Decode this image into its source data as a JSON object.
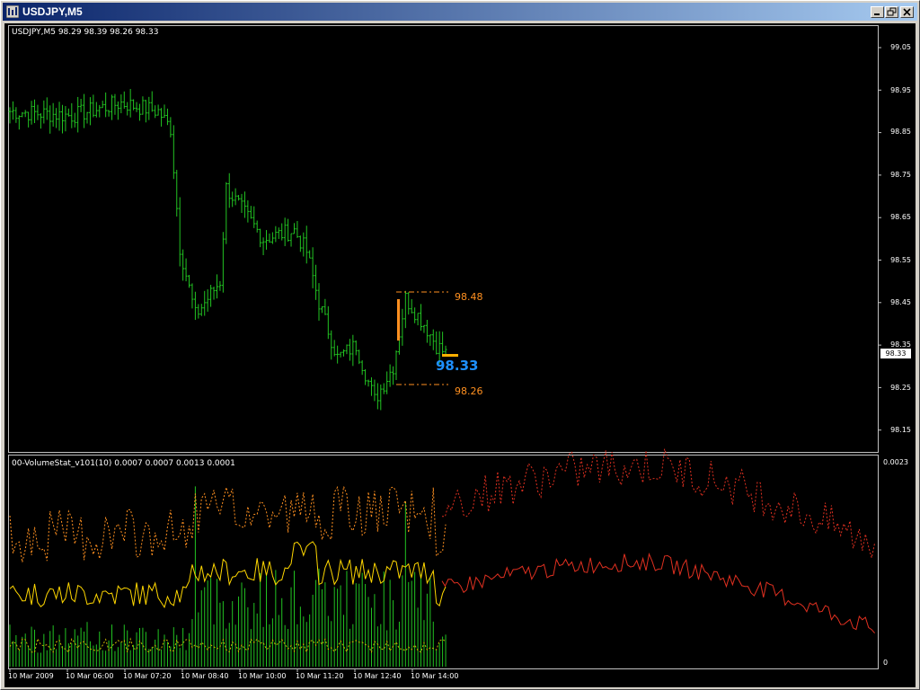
{
  "window": {
    "title": "USDJPY,M5",
    "controls": [
      "minimize",
      "restore",
      "close"
    ]
  },
  "chart": {
    "info_label": "USDJPY,M5  98.29 98.39 98.26 98.33",
    "price_ticks": [
      "99.05",
      "98.95",
      "98.85",
      "98.75",
      "98.65",
      "98.55",
      "98.45",
      "98.35",
      "98.25",
      "98.15"
    ],
    "current_price_box": "98.33",
    "range_high": "98.48",
    "range_low": "98.26",
    "current_price_big": "98.33",
    "colors": {
      "bars": "#22c422",
      "range_lines": "#ff9020",
      "current_price": "#1e90ff",
      "background": "#000000"
    }
  },
  "indicator": {
    "label": "00-VolumeStat_v101(10) 0.0007 0.0007 0.0013 0.0001",
    "scale_max": "0.0023",
    "scale_min": "0",
    "colors": {
      "volume_bars": "#22c422",
      "line_yellow": "#ffd700",
      "dotted_orange": "#ff9020",
      "projection_red": "#e03020"
    }
  },
  "time_axis": {
    "labels": [
      "10 Mar 2009",
      "10 Mar 06:00",
      "10 Mar 07:20",
      "10 Mar 08:40",
      "10 Mar 10:00",
      "10 Mar 11:20",
      "10 Mar 12:40",
      "10 Mar 14:00"
    ]
  }
}
